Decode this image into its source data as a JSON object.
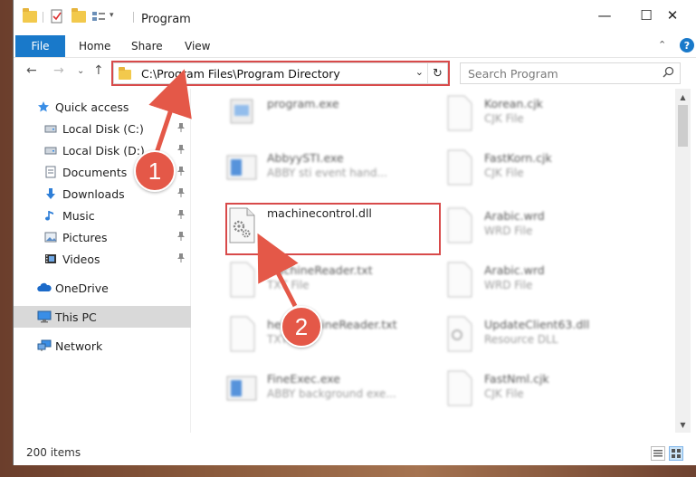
{
  "window": {
    "title": "Program",
    "minimize": "—",
    "maximize": "☐",
    "close": "✕"
  },
  "ribbon": {
    "tabs": [
      {
        "label": "File"
      },
      {
        "label": "Home"
      },
      {
        "label": "Share"
      },
      {
        "label": "View"
      }
    ],
    "collapse": "⌃",
    "help": "?"
  },
  "address": {
    "path": "C:\\Program Files\\Program Directory",
    "dropdown": "⌄",
    "refresh": "↻"
  },
  "nav_buttons": {
    "back": "←",
    "forward": "→",
    "history": "⌄",
    "up": "↑"
  },
  "search": {
    "placeholder": "Search Program",
    "icon": "search-icon"
  },
  "sidebar": {
    "items": [
      {
        "label": "Quick access",
        "icon": "star-icon"
      },
      {
        "label": "Local Disk (C:)",
        "icon": "drive-icon",
        "pin": "📌"
      },
      {
        "label": "Local Disk (D:)",
        "icon": "drive-icon",
        "pin": "📌"
      },
      {
        "label": "Documents",
        "icon": "documents-icon",
        "pin": "📌"
      },
      {
        "label": "Downloads",
        "icon": "download-icon",
        "pin": "📌"
      },
      {
        "label": "Music",
        "icon": "music-icon",
        "pin": "📌"
      },
      {
        "label": "Pictures",
        "icon": "pictures-icon",
        "pin": "📌"
      },
      {
        "label": "Videos",
        "icon": "videos-icon",
        "pin": "📌"
      },
      {
        "label": "OneDrive",
        "icon": "cloud-icon"
      },
      {
        "label": "This PC",
        "icon": "computer-icon"
      },
      {
        "label": "Network",
        "icon": "network-icon"
      }
    ]
  },
  "files": {
    "left": [
      {
        "name": "program.exe",
        "type": ""
      },
      {
        "name": "AbbyySTI.exe",
        "type": "ABBY sti event hand..."
      },
      {
        "name": "machinecontrol.dll",
        "type": ""
      },
      {
        "name": "MachineReader.txt",
        "type": "TXT File"
      },
      {
        "name": "helpMachineReader.txt",
        "type": "TXT File"
      },
      {
        "name": "FineExec.exe",
        "type": "ABBY background exe..."
      }
    ],
    "right": [
      {
        "name": "Korean.cjk",
        "type": "CJK File"
      },
      {
        "name": "FastKorn.cjk",
        "type": "CJK File"
      },
      {
        "name": "Arabic.wrd",
        "type": "WRD File"
      },
      {
        "name": "Arabic.wrd",
        "type": "WRD File"
      },
      {
        "name": "UpdateClient63.dll",
        "type": "Resource DLL"
      },
      {
        "name": "FastNml.cjk",
        "type": "CJK File"
      }
    ]
  },
  "status": {
    "item_count": "200 items"
  },
  "callouts": {
    "one": "1",
    "two": "2"
  },
  "colors": {
    "accent": "#1979ca",
    "highlight": "#d84a4a",
    "callout": "#e45848"
  }
}
